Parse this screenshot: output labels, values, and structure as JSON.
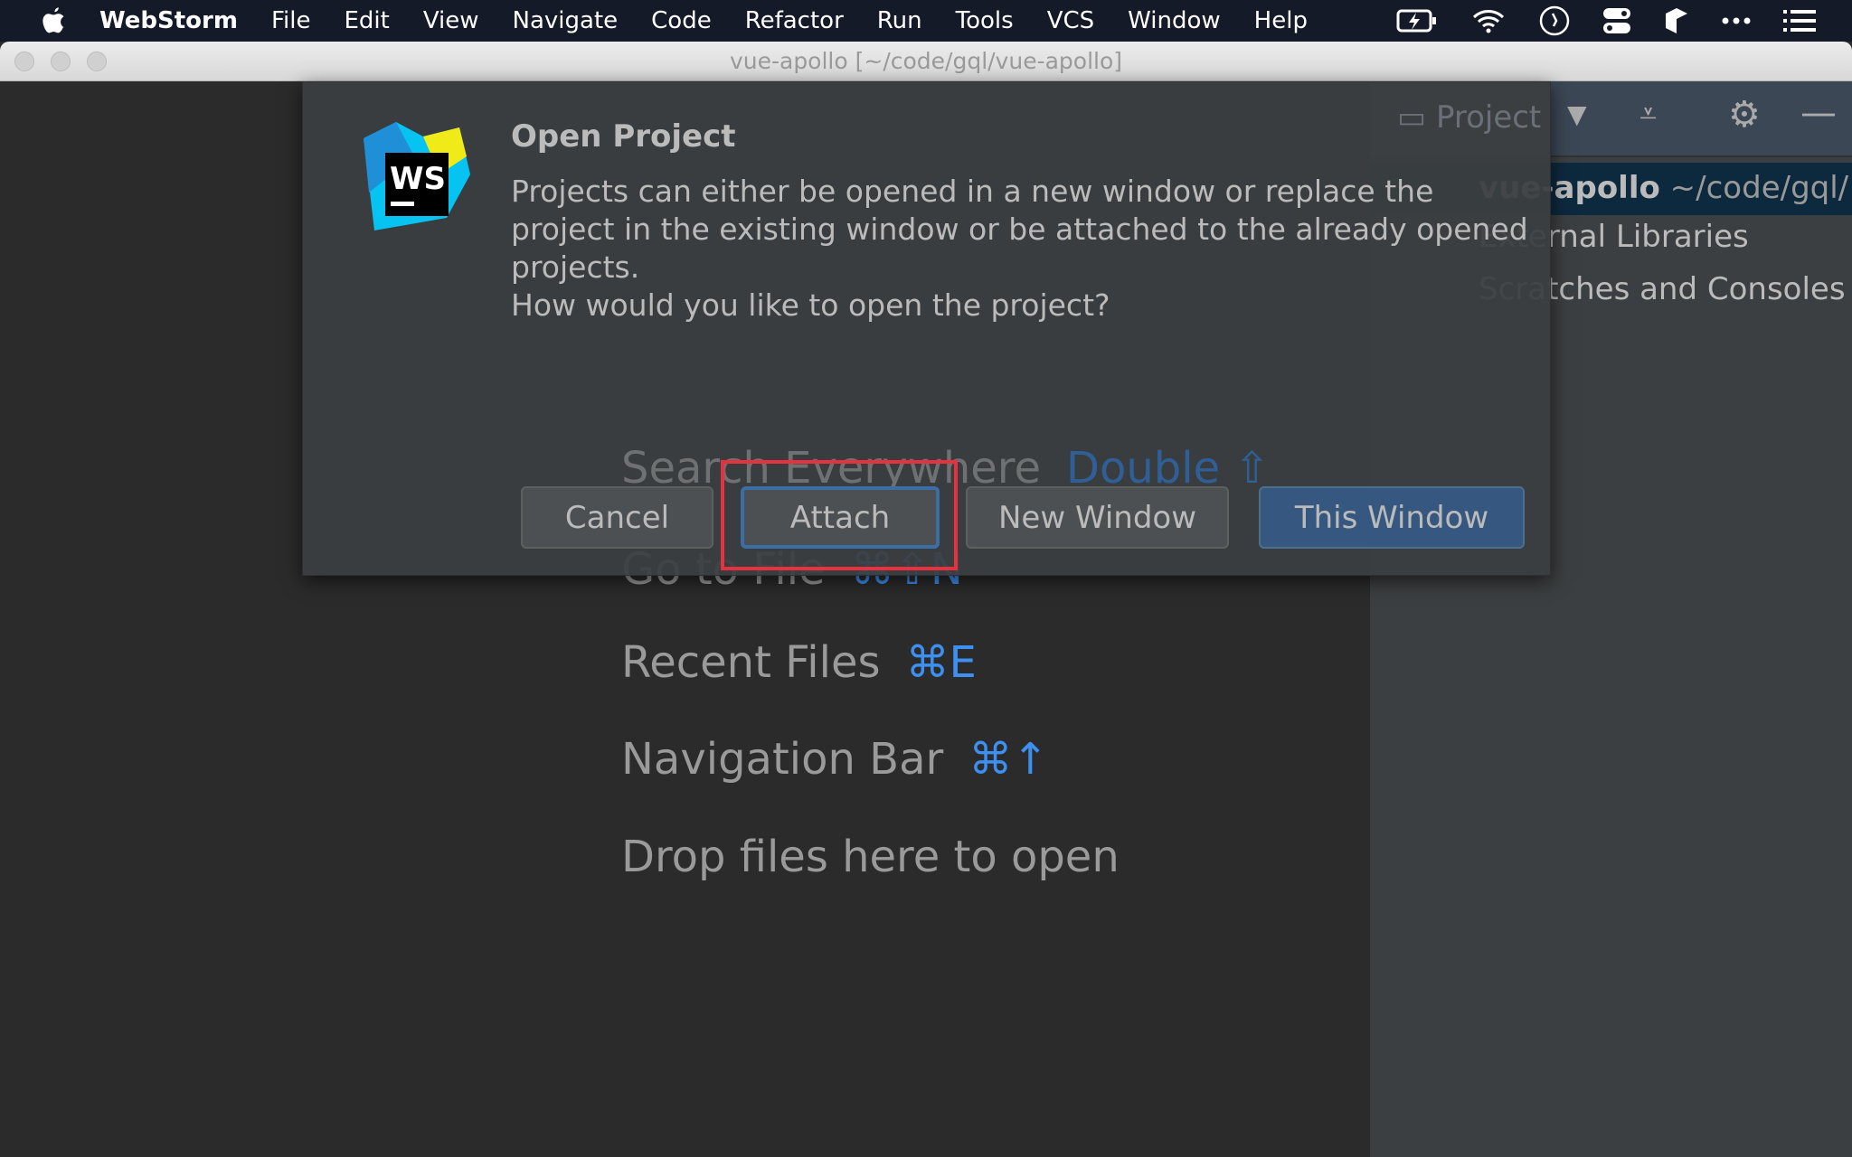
{
  "menubar": {
    "app": "WebStorm",
    "items": [
      "File",
      "Edit",
      "View",
      "Navigate",
      "Code",
      "Refactor",
      "Run",
      "Tools",
      "VCS",
      "Window",
      "Help"
    ],
    "tray_icons": [
      "battery-charging-icon",
      "wifi-icon",
      "clock-icon",
      "control-center-icon",
      "box-icon",
      "more-icon",
      "list-icon"
    ]
  },
  "window": {
    "title": "vue-apollo [~/code/gql/vue-apollo]"
  },
  "editor": {
    "hints": [
      {
        "label": "Search Everywhere",
        "key": "Double ⇧"
      },
      {
        "label": "Go to File",
        "key": "⌘⇧N"
      },
      {
        "label": "Recent Files",
        "key": "⌘E"
      },
      {
        "label": "Navigation Bar",
        "key": "⌘↑"
      },
      {
        "label": "Drop files here to open",
        "key": ""
      }
    ]
  },
  "project_panel": {
    "title": "Project",
    "root_name": "vue-apollo",
    "root_path": "~/code/gql/",
    "items": [
      "External Libraries",
      "Scratches and Consoles"
    ]
  },
  "dialog": {
    "title": "Open Project",
    "message_lines": [
      "Projects can either be opened in a new window or replace the",
      "project in the existing window or be attached to the already opened",
      "projects.",
      "How would you like to open the project?"
    ],
    "buttons": {
      "cancel": "Cancel",
      "attach": "Attach",
      "new_window": "New Window",
      "this_window": "This Window"
    },
    "logo_text": "WS"
  },
  "colors": {
    "accent": "#365880",
    "highlight": "#e8313f",
    "selection": "#0d293e",
    "shortcut": "#3d8ff0"
  }
}
